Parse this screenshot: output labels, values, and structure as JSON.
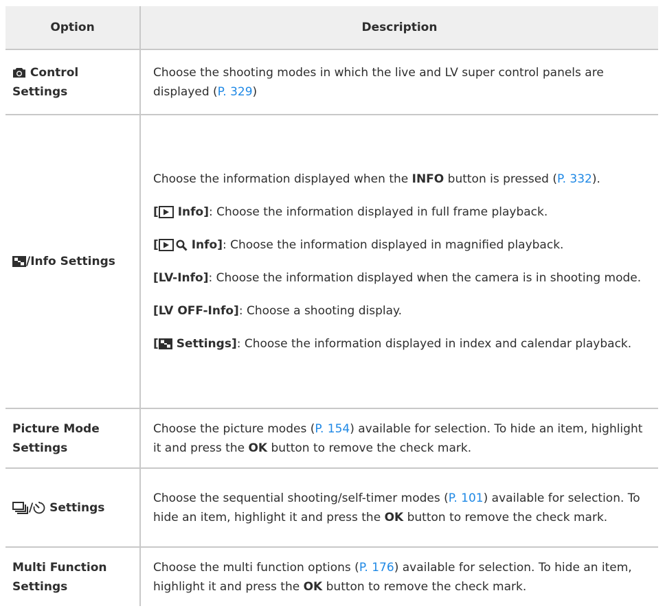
{
  "table": {
    "headers": {
      "option": "Option",
      "description": "Description"
    },
    "control_settings": {
      "option_label": "Control Settings",
      "desc_a": "Choose the shooting modes in which the live and LV super control panels are displayed (",
      "link": "P. 329",
      "desc_b": ")"
    },
    "info_settings": {
      "option_label": "/Info Settings",
      "intro_a": "Choose the information displayed when the ",
      "intro_b": "INFO",
      "intro_c": " button is pressed (",
      "intro_link": "P. 332",
      "intro_d": ").",
      "play_open": "[",
      "play_name": " Info]",
      "play_text": ": Choose the information displayed in full frame playback.",
      "mag_open": "[",
      "mag_name": " Info]",
      "mag_text": ": Choose the information displayed in magnified playback.",
      "lv_name": "[LV-Info]",
      "lv_text": ": Choose the information displayed when the camera is in shooting mode.",
      "lvoff_name": "[LV OFF-Info]",
      "lvoff_text": ": Choose a shooting display.",
      "idx_open": "[",
      "idx_name": " Settings]",
      "idx_text": ": Choose the information displayed in index and calendar playback."
    },
    "picture_mode": {
      "option_label": "Picture Mode Settings",
      "desc_a": "Choose the picture modes (",
      "link": "P. 154",
      "desc_b": ") available for selection. To hide an item, highlight it and press the ",
      "ok": "OK",
      "desc_c": " button to remove the check mark."
    },
    "drive_settings": {
      "option_label": " Settings",
      "desc_a": "Choose the sequential shooting/self-timer modes (",
      "link": "P. 101",
      "desc_b": ") available for selection. To hide an item, highlight it and press the ",
      "ok": "OK",
      "desc_c": " button to remove the check mark."
    },
    "multi_function": {
      "option_label": "Multi Function Settings",
      "desc_a": "Choose the multi function options (",
      "link": "P. 176",
      "desc_b": ") available for selection. To hide an item, highlight it and press the ",
      "ok": "OK",
      "desc_c": " button to remove the check mark."
    }
  },
  "icons": [
    "camera-icon",
    "index-grid-icon",
    "playback-icon",
    "magnify-icon",
    "sequential-shooting-icon",
    "self-timer-icon"
  ],
  "colors": {
    "link": "#1e88e5",
    "header_bg": "#efefef",
    "rule": "#c8c8c8",
    "text": "#2e2e2e"
  }
}
